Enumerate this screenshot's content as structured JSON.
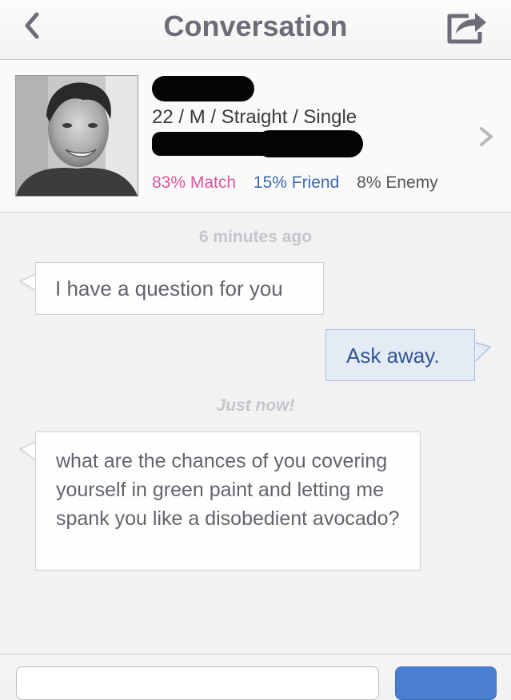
{
  "header": {
    "title": "Conversation",
    "back_icon": "chevron-left-icon",
    "share_icon": "share-icon"
  },
  "profile": {
    "details": "22 / M / Straight / Single",
    "match": "83% Match",
    "friend": "15% Friend",
    "enemy": "8% Enemy",
    "match_color": "#e0559a",
    "friend_color": "#3e6ab0",
    "chevron_icon": "chevron-right-icon"
  },
  "messages": [
    {
      "timestamp": "6 minutes ago"
    },
    {
      "side": "received",
      "text": "I have a question for you"
    },
    {
      "side": "sent",
      "text": "Ask away."
    },
    {
      "timestamp": "Just now!"
    },
    {
      "side": "received",
      "text": "what are the chances of you covering yourself in green paint and letting me spank you like a disobedient avocado?"
    }
  ],
  "colors": {
    "sent_bubble": "#e4ebf5",
    "sent_text": "#2f5594",
    "send_button": "#4a7fd0"
  }
}
